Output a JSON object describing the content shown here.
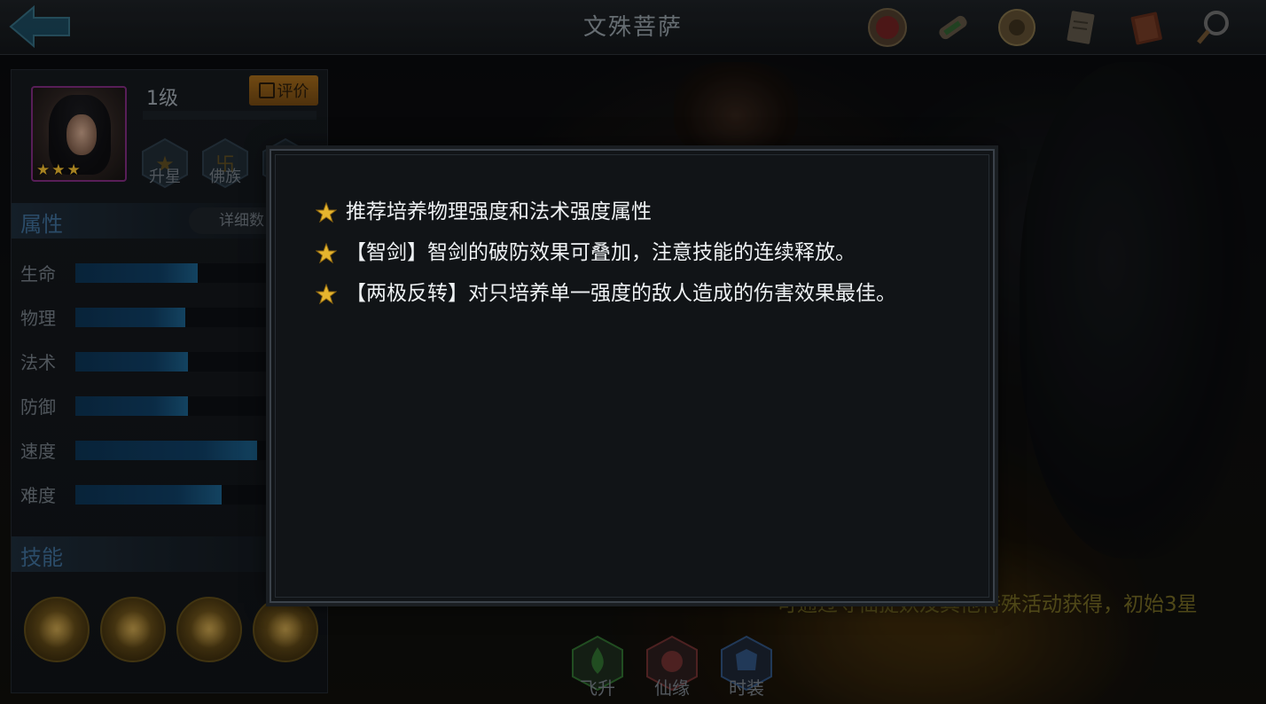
{
  "header": {
    "title": "文殊菩萨",
    "icons": [
      "seal-icon",
      "scroll-icon",
      "coin-icon",
      "document-icon",
      "book-icon",
      "magnifier-icon"
    ]
  },
  "hero": {
    "level": "1级",
    "rate_label": "评价",
    "stars": 3,
    "actions": [
      {
        "label": "升星"
      },
      {
        "label": "佛族"
      }
    ]
  },
  "attributes": {
    "title": "属性",
    "detail_label": "详细数",
    "stats": [
      {
        "label": "生命",
        "value": 0.51
      },
      {
        "label": "物理",
        "value": 0.46
      },
      {
        "label": "法术",
        "value": 0.47
      },
      {
        "label": "防御",
        "value": 0.47
      },
      {
        "label": "速度",
        "value": 0.76
      },
      {
        "label": "难度",
        "value": 0.61
      }
    ]
  },
  "skills": {
    "title": "技能",
    "items": [
      "skill-1-icon",
      "skill-2-icon",
      "skill-3-icon",
      "skill-4-icon"
    ]
  },
  "bottom_tabs": [
    {
      "label": "飞升",
      "color": "#2f6b2f"
    },
    {
      "label": "仙缘",
      "color": "#6b2f2f"
    },
    {
      "label": "时装",
      "color": "#2f4f7a"
    }
  ],
  "source_text": "可通过寻仙捉妖及其他特殊活动获得，初始3星",
  "modal": {
    "tips": [
      "推荐培养物理强度和法术强度属性",
      "【智剑】智剑的破防效果可叠加，注意技能的连续释放。",
      "【两极反转】对只培养单一强度的敌人造成的伤害效果最佳。"
    ]
  },
  "colors": {
    "accent_blue": "#3c6a92",
    "star_gold": "#e6b52e",
    "rate_orange": "#b4741a"
  }
}
